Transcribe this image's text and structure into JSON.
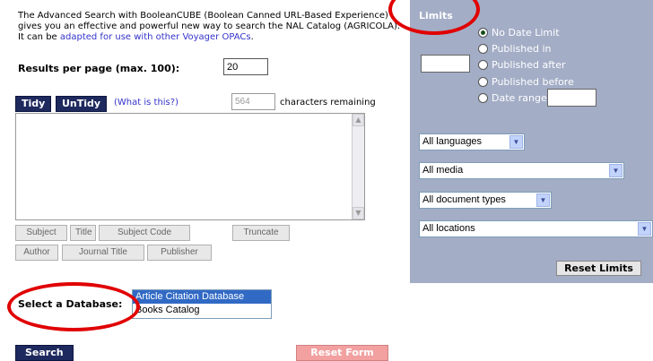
{
  "intro": {
    "text": "The Advanced Search with BooleanCUBE (Boolean Canned URL-Based Experience) gives you an effective and powerful new way to search the NAL Catalog (AGRICOLA). It can be ",
    "link": "adapted for use with other Voyager OPACs",
    "end": "."
  },
  "results": {
    "label": "Results per page (max. 100):",
    "value": "20"
  },
  "editor": {
    "tidy_label": "Tidy",
    "untidy_label": "UnTidy",
    "whatis_label": "(What is this?)",
    "char_count": "564",
    "char_label": "characters remaining",
    "query": "",
    "scroll_up": "▲",
    "scroll_down": "▼"
  },
  "field_buttons": {
    "subject": "Subject",
    "title": "Title",
    "subject_code": "Subject Code",
    "truncate": "Truncate",
    "author": "Author",
    "journal_title": "Journal Title",
    "publisher": "Publisher"
  },
  "database": {
    "label": "Select a Database:",
    "options": [
      "Article Citation Database",
      "Books Catalog"
    ],
    "selected_index": 0
  },
  "actions": {
    "search_label": "Search",
    "reset_form_label": "Reset Form"
  },
  "limits": {
    "title": "Limits",
    "date_options": [
      "No Date Limit",
      "Published in",
      "Published after",
      "Published before",
      "Date range"
    ],
    "selected_date_option": 0,
    "language": "All languages",
    "media": "All media",
    "doc_types": "All document types",
    "locations": "All locations",
    "dropdown_glyph": "▼",
    "reset_label": "Reset Limits"
  },
  "colors": {
    "highlight_ellipse": "#e00000",
    "limits_panel": "#a3adc6",
    "button_dark": "#1e2a5e",
    "reset_form": "#f2a0a0",
    "link": "#3333cc"
  }
}
